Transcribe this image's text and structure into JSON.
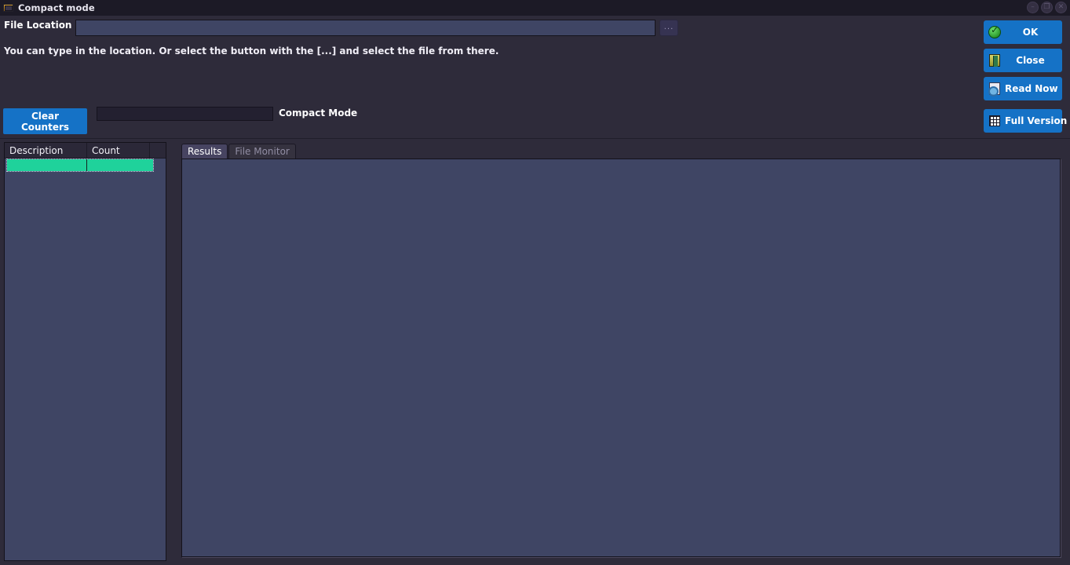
{
  "window": {
    "title": "Compact mode",
    "icon": "folder-window-icon",
    "controls": [
      {
        "name": "minimize",
        "glyph": "–"
      },
      {
        "name": "maximize",
        "glyph": "❐"
      },
      {
        "name": "close",
        "glyph": "✕"
      }
    ]
  },
  "file_location": {
    "label": "File Location",
    "value": "",
    "placeholder": "",
    "browse_label": "...",
    "hint": "You can type in the location. Or select the button with the [...] and select the file from there."
  },
  "actions": [
    {
      "id": "ok",
      "label": "OK",
      "icon": "green-check-icon"
    },
    {
      "id": "close",
      "label": "Close",
      "icon": "door-exit-icon"
    },
    {
      "id": "read",
      "label": "Read Now",
      "icon": "document-search-icon"
    },
    {
      "id": "full",
      "label": "Full Version",
      "icon": "grid-table-icon"
    }
  ],
  "toolbar": {
    "clear_counters_label": "Clear Counters",
    "progress_value": "",
    "mode_label": "Compact Mode"
  },
  "counters": {
    "columns": [
      "Description",
      "Count"
    ],
    "rows": [
      {
        "description": "",
        "count": "",
        "selected": true
      }
    ]
  },
  "tabs": [
    {
      "id": "results",
      "label": "Results",
      "active": true
    },
    {
      "id": "file-monitor",
      "label": "File Monitor",
      "active": false
    }
  ],
  "results": {
    "content": ""
  },
  "colors": {
    "window_bg": "#2e2b3a",
    "titlebar_bg": "#1c1a26",
    "panel_bg": "#3f4564",
    "accent_blue": "#1572c6",
    "row_highlight": "#1fd29b",
    "text_primary": "#ffffff"
  }
}
